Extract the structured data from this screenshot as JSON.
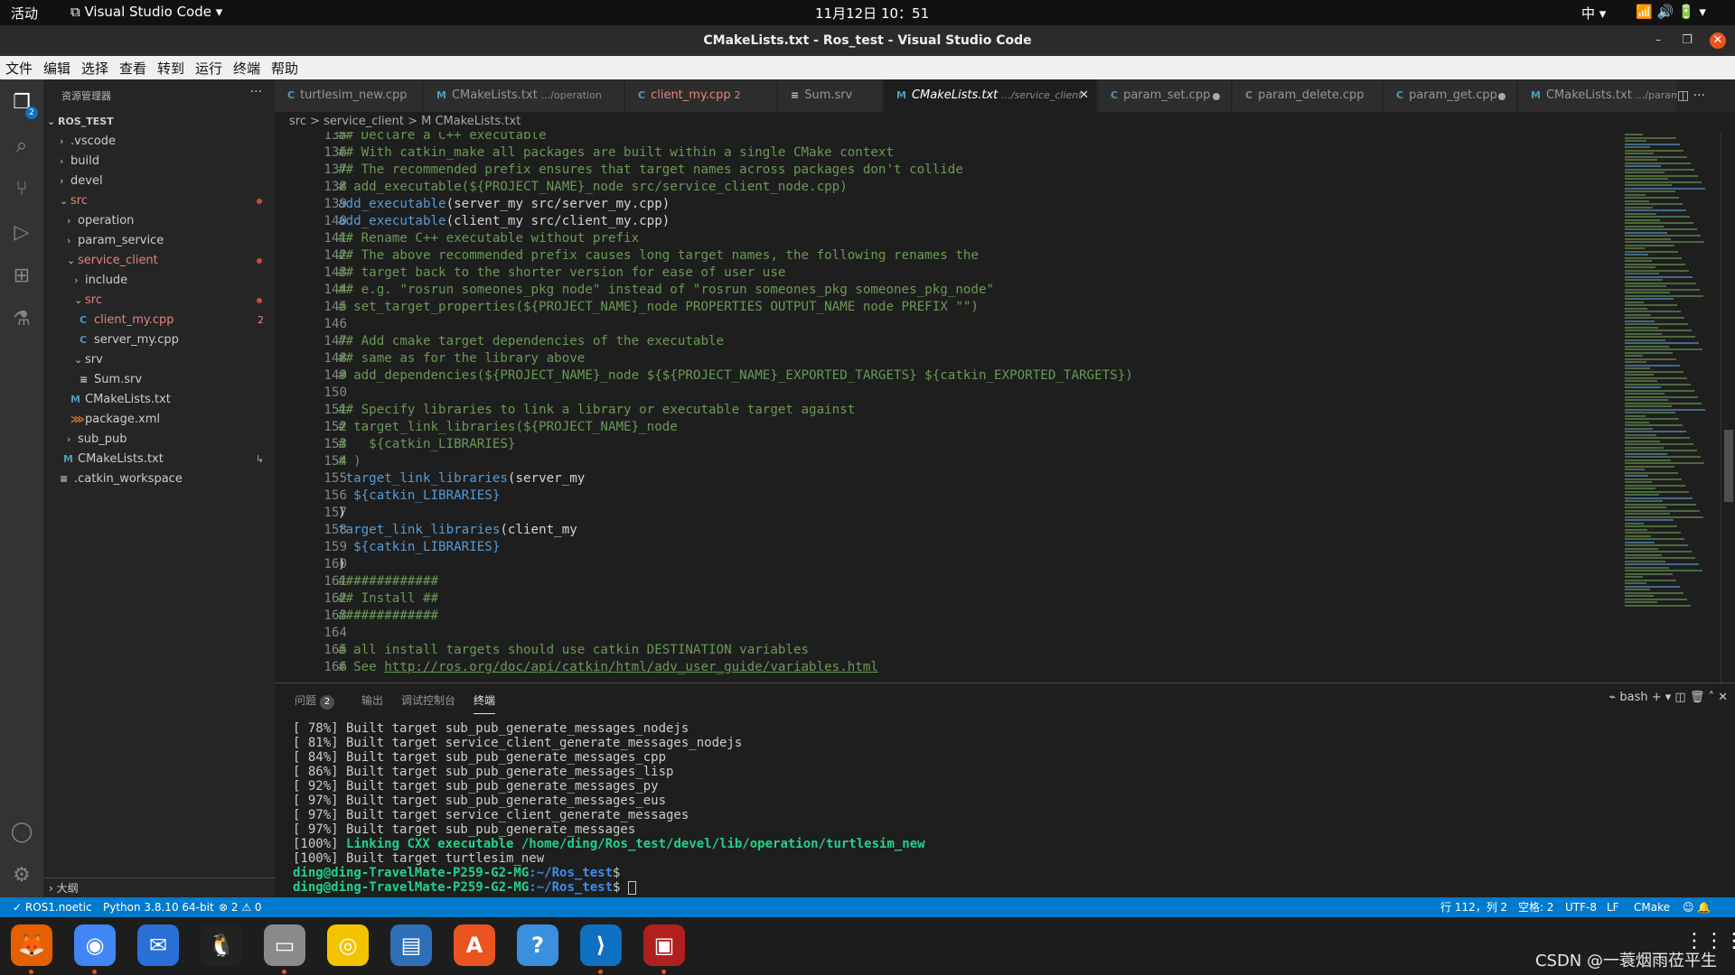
{
  "gnome_bar": {
    "activities": "活动",
    "app_name": "Visual Studio Code ▾",
    "clock": "11月12日  10：51",
    "input_method": "中 ▾",
    "tray": "📶  🔊  🔋 ▾"
  },
  "window": {
    "title": "CMakeLists.txt - Ros_test - Visual Studio Code",
    "minimize": "–",
    "maximize": "❐",
    "close": "✕"
  },
  "menu": [
    "文件",
    "编辑",
    "选择",
    "查看",
    "转到",
    "运行",
    "终端",
    "帮助"
  ],
  "activity_bar": {
    "explorer_badge": "2"
  },
  "sidebar": {
    "header": "资源管理器",
    "more": "···",
    "root": "ROS_TEST",
    "items": [
      {
        "label": ".vscode"
      },
      {
        "label": "build"
      },
      {
        "label": "devel"
      },
      {
        "label": "src"
      },
      {
        "label": "operation"
      },
      {
        "label": "param_service"
      },
      {
        "label": "service_client"
      },
      {
        "label": "include"
      },
      {
        "label": "src"
      },
      {
        "label": "client_my.cpp",
        "badge": "2"
      },
      {
        "label": "server_my.cpp"
      },
      {
        "label": "srv"
      },
      {
        "label": "Sum.srv"
      },
      {
        "label": "CMakeLists.txt"
      },
      {
        "label": "package.xml"
      },
      {
        "label": "sub_pub"
      },
      {
        "label": "CMakeLists.txt",
        "badge": "↳"
      },
      {
        "label": ".catkin_workspace"
      }
    ],
    "outline": "大纲"
  },
  "tabs": [
    {
      "icon": "C",
      "label": "turtlesim_new.cpp",
      "desc": ""
    },
    {
      "icon": "M",
      "label": "CMakeLists.txt",
      "desc": ".../operation"
    },
    {
      "icon": "C",
      "label": "client_my.cpp",
      "desc": "2"
    },
    {
      "icon": "≡",
      "label": "Sum.srv",
      "desc": ""
    },
    {
      "icon": "M",
      "label": "CMakeLists.txt",
      "desc": ".../service_client",
      "close": "✕"
    },
    {
      "icon": "C",
      "label": "param_set.cpp",
      "desc": ""
    },
    {
      "icon": "C",
      "label": "param_delete.cpp",
      "desc": ""
    },
    {
      "icon": "C",
      "label": "param_get.cpp",
      "desc": ""
    },
    {
      "icon": "M",
      "label": "CMakeLists.txt",
      "desc": ".../param_s"
    }
  ],
  "tab_actions": "◫  ···",
  "breadcrumb": {
    "part1": "src",
    "sep": " > ",
    "part2": "service_client",
    "part3": "M CMakeLists.txt"
  },
  "code_lines": [
    {
      "n": "135",
      "t": "## Declare a C++ executable"
    },
    {
      "n": "136",
      "t": "## With catkin_make all packages are built within a single CMake context"
    },
    {
      "n": "137",
      "t": "## The recommended prefix ensures that target names across packages don't collide"
    },
    {
      "n": "138",
      "t": "# add_executable(${PROJECT_NAME}_node src/service_client_node.cpp)"
    },
    {
      "n": "139",
      "f": "add_executable",
      "t": "(server_my src/server_my.cpp)"
    },
    {
      "n": "140",
      "f": "add_executable",
      "t": "(client_my src/client_my.cpp)"
    },
    {
      "n": "141",
      "t": "## Rename C++ executable without prefix"
    },
    {
      "n": "142",
      "t": "## The above recommended prefix causes long target names, the following renames the"
    },
    {
      "n": "143",
      "t": "## target back to the shorter version for ease of user use"
    },
    {
      "n": "144",
      "t": "## e.g. \"rosrun someones_pkg node\" instead of \"rosrun someones_pkg someones_pkg_node\""
    },
    {
      "n": "145",
      "t": "# set_target_properties(${PROJECT_NAME}_node PROPERTIES OUTPUT_NAME node PREFIX \"\")"
    },
    {
      "n": "146",
      "t": ""
    },
    {
      "n": "147",
      "t": "## Add cmake target dependencies of the executable"
    },
    {
      "n": "148",
      "t": "## same as for the library above"
    },
    {
      "n": "149",
      "t": "# add_dependencies(${PROJECT_NAME}_node ${${PROJECT_NAME}_EXPORTED_TARGETS} ${catkin_EXPORTED_TARGETS})"
    },
    {
      "n": "150",
      "t": ""
    },
    {
      "n": "151",
      "t": "## Specify libraries to link a library or executable target against"
    },
    {
      "n": "152",
      "t": "# target_link_libraries(${PROJECT_NAME}_node"
    },
    {
      "n": "153",
      "t": "#   ${catkin_LIBRARIES}"
    },
    {
      "n": "154",
      "t": "# )"
    },
    {
      "n": "155",
      "p": " ",
      "f": "target_link_libraries",
      "t": "(server_my"
    },
    {
      "n": "156",
      "p": "  ",
      "v": "${catkin_LIBRARIES}"
    },
    {
      "n": "157",
      "t": ")"
    },
    {
      "n": "158",
      "f": "target_link_libraries",
      "t": "(client_my"
    },
    {
      "n": "159",
      "p": "  ",
      "v": "${catkin_LIBRARIES}"
    },
    {
      "n": "160",
      "t": ")"
    },
    {
      "n": "161",
      "t": "#############"
    },
    {
      "n": "162",
      "t": "## Install ##"
    },
    {
      "n": "163",
      "t": "#############"
    },
    {
      "n": "164",
      "t": ""
    },
    {
      "n": "165",
      "t": "# all install targets should use catkin DESTINATION variables"
    },
    {
      "n": "166",
      "t": "# See ",
      "link": "http://ros.org/doc/api/catkin/html/adv_user_guide/variables.html"
    }
  ],
  "panel": {
    "tabs": [
      "问题",
      "输出",
      "调试控制台",
      "终端"
    ],
    "problems_count": "2",
    "actions": "⌁ bash  +  ▾   ◫   🗑   ˄   ✕",
    "terminal_lines": [
      "[ 78%] Built target sub_pub_generate_messages_nodejs",
      "[ 81%] Built target service_client_generate_messages_nodejs",
      "[ 84%] Built target sub_pub_generate_messages_cpp",
      "[ 86%] Built target sub_pub_generate_messages_lisp",
      "[ 92%] Built target sub_pub_generate_messages_py",
      "[ 97%] Built target sub_pub_generate_messages_eus",
      "[ 97%] Built target service_client_generate_messages",
      "[ 97%] Built target sub_pub_generate_messages"
    ],
    "link_prefix": "[100%] ",
    "link_line": "Linking CXX executable /home/ding/Ros_test/devel/lib/operation/turtlesim_new",
    "last_built": "[100%] Built target turtlesim_new",
    "prompt_user": "ding@ding-TravelMate-P259-G2-MG",
    "prompt_path": ":~/Ros_test",
    "prompt_end": "$"
  },
  "statusbar": {
    "ros": "✓ ROS1.noetic",
    "python": "Python 3.8.10 64-bit",
    "problems": "⊗ 2 ⚠ 0",
    "position": "行 112，列 2",
    "spaces": "空格: 2",
    "encoding": "UTF-8",
    "eol": "LF",
    "language": "CMake",
    "feedback": "☺  🔔"
  },
  "dock": {
    "apps": [
      {
        "name": "firefox",
        "glyph": "🦊",
        "color": "#e66000"
      },
      {
        "name": "chrome",
        "glyph": "◉",
        "color": "#4285f4"
      },
      {
        "name": "thunderbird",
        "glyph": "✉",
        "color": "#2a6fd6"
      },
      {
        "name": "qq",
        "glyph": "🐧",
        "color": "#222222"
      },
      {
        "name": "files",
        "glyph": "▭",
        "color": "#8a8a8a"
      },
      {
        "name": "rhythmbox",
        "glyph": "◎",
        "color": "#f3c300"
      },
      {
        "name": "writer",
        "glyph": "▤",
        "color": "#2f6fb8"
      },
      {
        "name": "software",
        "glyph": "A",
        "color": "#e95420"
      },
      {
        "name": "help",
        "glyph": "?",
        "color": "#3a8fde"
      },
      {
        "name": "vscode",
        "glyph": "⟩",
        "color": "#0e70c0"
      },
      {
        "name": "terminal",
        "glyph": "▣",
        "color": "#b02020"
      }
    ],
    "grid": "⋮⋮⋮",
    "watermark": "CSDN @一蓑烟雨莅平生"
  }
}
